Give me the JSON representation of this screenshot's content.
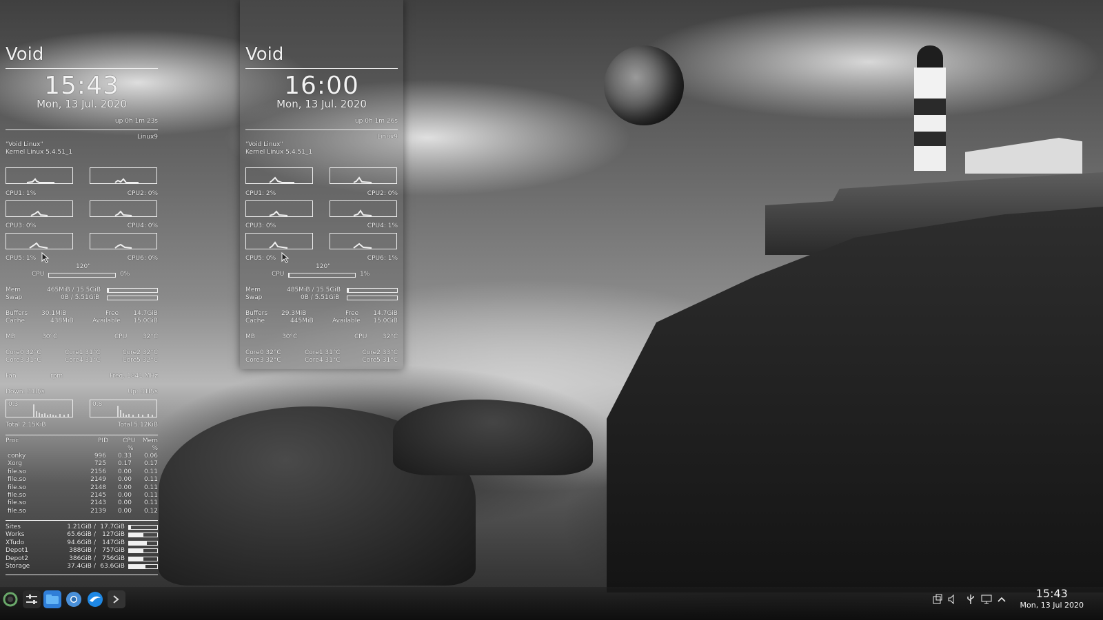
{
  "conky_left": {
    "title": "Void",
    "time": "15:43",
    "date": "Mon, 13 Jul. 2020",
    "uptime": "up  0h 1m 23s",
    "host": "Linux9",
    "distro": "\"Void Linux\"",
    "kernel": "Kernel Linux 5.4.51_1",
    "cpu_labels": [
      "CPU1: 1%",
      "CPU2: 0%",
      "CPU3: 0%",
      "CPU4: 0%",
      "CPU5: 1%",
      "CPU6: 0%"
    ],
    "temp_cpu_top": "120\"",
    "cpu_total_label": "CPU",
    "cpu_total_value": "0%",
    "cpu_total_fraction": 0.0,
    "mem_label": "Mem",
    "mem_value": "465MiB / 15.5GiB",
    "mem_fraction": 0.03,
    "swap_label": "Swap",
    "swap_value": "0B / 5.51GiB",
    "swap_fraction": 0.0,
    "buffers_label": "Buffers",
    "buffers_value": "30.1MiB",
    "free_label": "Free",
    "free_value": "14.7GiB",
    "cache_label": "Cache",
    "cache_value": "438MiB",
    "available_label": "Available",
    "available_value": "15.0GiB",
    "mb_label": "MB",
    "mb_value": "30°C",
    "cpu_temp_label": "CPU",
    "cpu_temp_value": "32°C",
    "cores_row1": [
      "Core0  32°C",
      "Core1  31°C",
      "Core2  32°C"
    ],
    "cores_row2": [
      "Core3  31°C",
      "Core4  31°C",
      "Core5  32°C"
    ],
    "fan_label": "Fan",
    "fan_rpm": "rpm",
    "freq_label": "Freq.  1841   MHz",
    "down_label": "Down: 31B/s",
    "up_label": "Up: 31B/s",
    "net_down_scale": "0.3",
    "net_up_scale": "0.8",
    "total_down": "Total 2.15KiB",
    "total_up": "Total 5.12KiB",
    "proc_headers": [
      "Proc",
      "PID",
      "CPU",
      "Mem"
    ],
    "proc_units": [
      "%",
      "%"
    ],
    "processes": [
      {
        "name": "conky",
        "pid": "996",
        "cpu": "0.33",
        "mem": "0.06"
      },
      {
        "name": "Xorg",
        "pid": "725",
        "cpu": "0.17",
        "mem": "0.17"
      },
      {
        "name": "file.so",
        "pid": "2156",
        "cpu": "0.00",
        "mem": "0.11"
      },
      {
        "name": "file.so",
        "pid": "2149",
        "cpu": "0.00",
        "mem": "0.11"
      },
      {
        "name": "file.so",
        "pid": "2148",
        "cpu": "0.00",
        "mem": "0.11"
      },
      {
        "name": "file.so",
        "pid": "2145",
        "cpu": "0.00",
        "mem": "0.11"
      },
      {
        "name": "file.so",
        "pid": "2143",
        "cpu": "0.00",
        "mem": "0.11"
      },
      {
        "name": "file.so",
        "pid": "2139",
        "cpu": "0.00",
        "mem": "0.12"
      }
    ],
    "disks": [
      {
        "name": "Sites",
        "used": "1.21GiB",
        "sep": "/",
        "total": "17.7GiB",
        "fraction": 0.07
      },
      {
        "name": "Works",
        "used": "65.6GiB",
        "sep": "/",
        "total": "127GiB",
        "fraction": 0.52
      },
      {
        "name": "XTudo",
        "used": "94.6GiB",
        "sep": "/",
        "total": "147GiB",
        "fraction": 0.64
      },
      {
        "name": "Depot1",
        "used": "388GiB",
        "sep": "/",
        "total": "757GiB",
        "fraction": 0.51
      },
      {
        "name": "Depot2",
        "used": "386GiB",
        "sep": "/",
        "total": "756GiB",
        "fraction": 0.51
      },
      {
        "name": "Storage",
        "used": "37.4GiB",
        "sep": "/",
        "total": "63.6GiB",
        "fraction": 0.59
      }
    ]
  },
  "conky_right": {
    "title": "Void",
    "time": "16:00",
    "date": "Mon, 13 Jul. 2020",
    "uptime": "up  0h 1m 26s",
    "host": "Linux9",
    "distro": "\"Void Linux\"",
    "kernel": "Kernel Linux 5.4.51_1",
    "cpu_labels": [
      "CPU1: 2%",
      "CPU2: 0%",
      "CPU3: 0%",
      "CPU4: 1%",
      "CPU5: 0%",
      "CPU6: 1%"
    ],
    "temp_cpu_top": "120\"",
    "cpu_total_label": "CPU",
    "cpu_total_value": "1%",
    "cpu_total_fraction": 0.01,
    "mem_label": "Mem",
    "mem_value": "485MiB / 15.5GiB",
    "mem_fraction": 0.03,
    "swap_label": "Swap",
    "swap_value": "0B / 5.51GiB",
    "swap_fraction": 0.0,
    "buffers_label": "Buffers",
    "buffers_value": "29.3MiB",
    "free_label": "Free",
    "free_value": "14.7GiB",
    "cache_label": "Cache",
    "cache_value": "445MiB",
    "available_label": "Available",
    "available_value": "15.0GiB",
    "mb_label": "MB",
    "mb_value": "30°C",
    "cpu_temp_label": "CPU",
    "cpu_temp_value": "32°C",
    "cores_row1": [
      "Core0  32°C",
      "Core1  31°C",
      "Core2  33°C"
    ],
    "cores_row2": [
      "Core3  32°C",
      "Core4  31°C",
      "Core5  31°C"
    ]
  },
  "taskbar": {
    "launchers": [
      "void-logo-icon",
      "settings-icon",
      "file-manager-icon",
      "chromium-icon",
      "browser-icon",
      "terminal-icon"
    ],
    "tray_icons": [
      "window-icon",
      "volume-icon",
      "usb-icon",
      "display-icon",
      "chevron-up-icon"
    ],
    "clock_time": "15:43",
    "clock_date": "Mon, 13 Jul 2020"
  },
  "colors": {
    "accent": "#f0f0f0",
    "panel": "#5a5a5a",
    "taskbar": "#141414"
  }
}
